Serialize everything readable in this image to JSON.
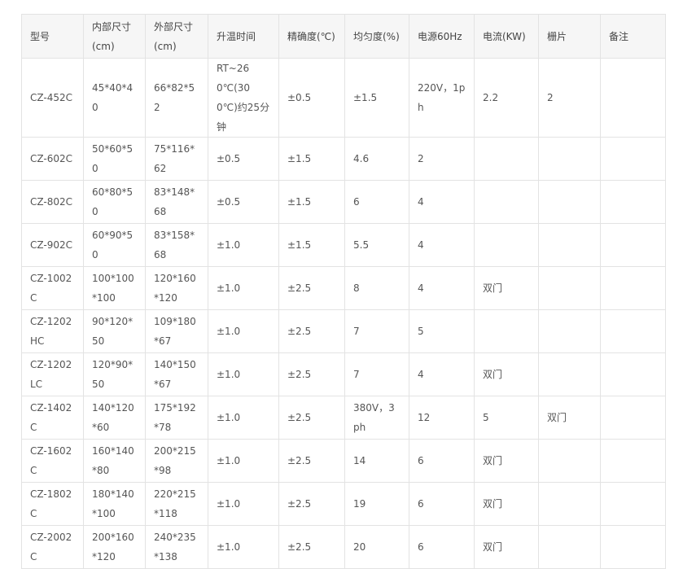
{
  "table": {
    "headers": [
      "型号",
      "内部尺寸(cm)",
      "外部尺寸(cm)",
      "升温时间",
      "精确度(℃)",
      "均匀度(%)",
      "电源60Hz",
      "电流(KW)",
      "栅片",
      "备注"
    ],
    "rows": [
      [
        "CZ-452C",
        "45*40*40",
        "66*82*52",
        "RT~260℃(300℃)约25分钟",
        "±0.5",
        "±1.5",
        "220V，1ph",
        "2.2",
        "2",
        ""
      ],
      [
        "CZ-602C",
        "50*60*50",
        "75*116*62",
        "±0.5",
        "±1.5",
        "4.6",
        "2",
        "",
        "",
        ""
      ],
      [
        "CZ-802C",
        "60*80*50",
        "83*148*68",
        "±0.5",
        "±1.5",
        "6",
        "4",
        "",
        "",
        ""
      ],
      [
        "CZ-902C",
        "60*90*50",
        "83*158*68",
        "±1.0",
        "±1.5",
        "5.5",
        "4",
        "",
        "",
        ""
      ],
      [
        "CZ-1002C",
        "100*100*100",
        "120*160*120",
        "±1.0",
        "±2.5",
        "8",
        "4",
        "双门",
        "",
        ""
      ],
      [
        "CZ-1202HC",
        "90*120*50",
        "109*180*67",
        "±1.0",
        "±2.5",
        "7",
        "5",
        "",
        "",
        ""
      ],
      [
        "CZ-1202LC",
        "120*90*50",
        "140*150*67",
        "±1.0",
        "±2.5",
        "7",
        "4",
        "双门",
        "",
        ""
      ],
      [
        "CZ-1402C",
        "140*120*60",
        "175*192*78",
        "±1.0",
        "±2.5",
        "380V，3ph",
        "12",
        "5",
        "双门",
        ""
      ],
      [
        "CZ-1602C",
        "160*140*80",
        "200*215*98",
        "±1.0",
        "±2.5",
        "14",
        "6",
        "双门",
        "",
        ""
      ],
      [
        "CZ-1802C",
        "180*140*100",
        "220*215*118",
        "±1.0",
        "±2.5",
        "19",
        "6",
        "双门",
        "",
        ""
      ],
      [
        "CZ-2002C",
        "200*160*120",
        "240*235*138",
        "±1.0",
        "±2.5",
        "20",
        "6",
        "双门",
        "",
        ""
      ]
    ]
  }
}
